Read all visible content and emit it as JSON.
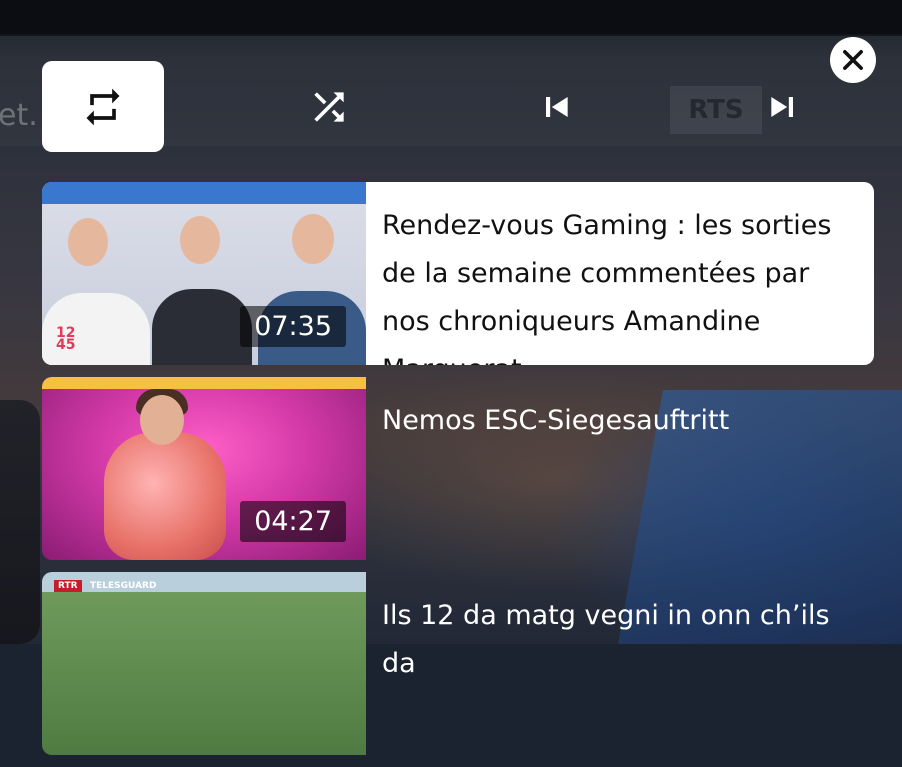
{
  "background": {
    "ghost_text": "et.",
    "ghost_logo": "RTS"
  },
  "controls": {
    "repeat_icon": "repeat-icon",
    "shuffle_icon": "shuffle-icon",
    "prev_icon": "skip-previous-icon",
    "next_icon": "skip-next-icon",
    "close_icon": "close-icon"
  },
  "playlist": {
    "items": [
      {
        "title": "Rendez-vous Gaming : les sorties de la semaine commentées par nos chroniqueurs Amandine Marguerat",
        "duration": "07:35",
        "badge": "12\n45",
        "active": true
      },
      {
        "title": "Nemos ESC-Siegesauftritt",
        "duration": "04:27",
        "active": false
      },
      {
        "title": "Ils 12 da matg vegni in onn ch’ils da",
        "duration": "",
        "logo": "RTR",
        "logo_label": "TELESGUARD",
        "active": false
      }
    ]
  },
  "colors": {
    "active_bg": "#ffffff",
    "overlay_text": "#ffffff"
  }
}
